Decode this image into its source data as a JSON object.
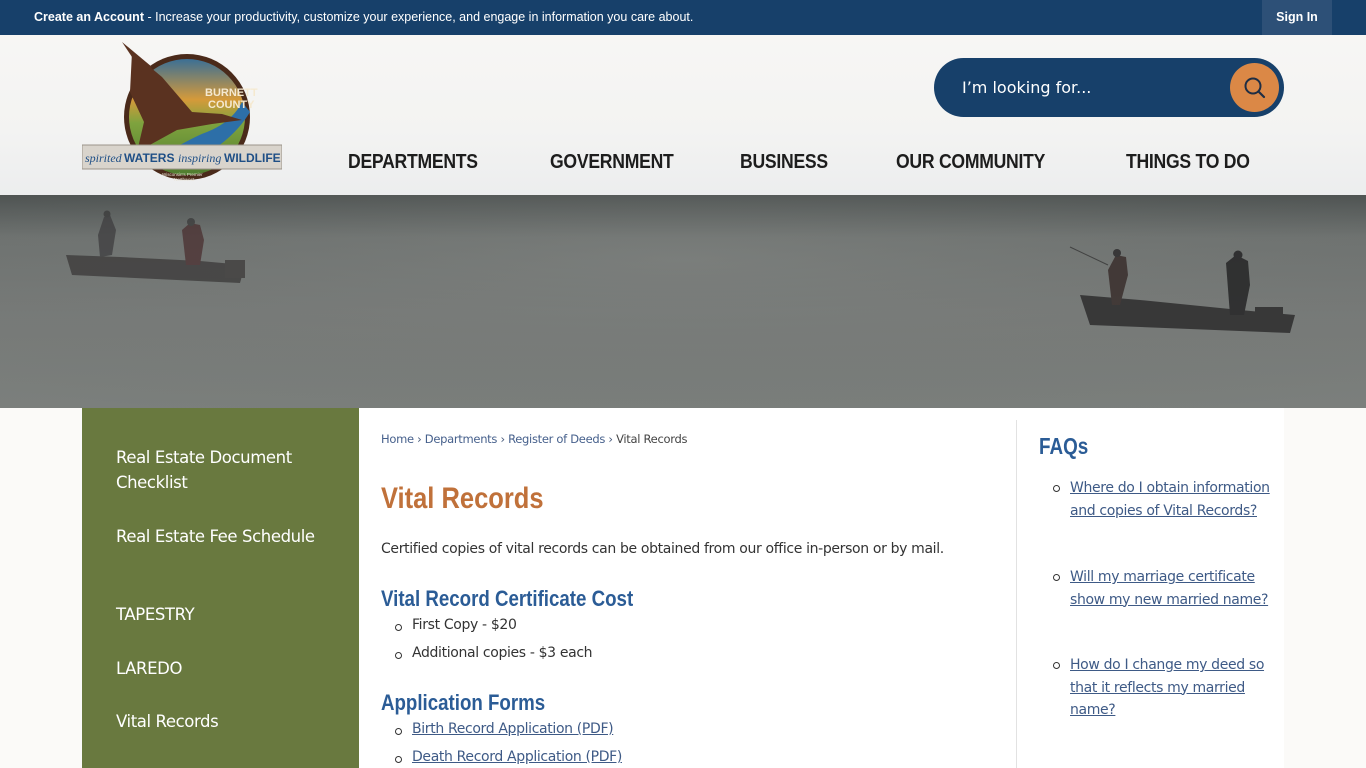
{
  "topbar": {
    "promo_link": "Create an Account",
    "promo_text": " - Increase your productivity, customize your experience, and engage in information you care about.",
    "sign_in": "Sign In"
  },
  "logo": {
    "line1": "BURNETT",
    "line2": "COUNTY",
    "tagline_a": "spirited",
    "tagline_b": "WATERS",
    "tagline_c": "inspiring",
    "tagline_d": "WILDLIFE",
    "sub1": "Wisconsin's Premier",
    "sub2": "Northwest"
  },
  "search": {
    "placeholder": "I’m looking for...",
    "icon": "search-icon"
  },
  "nav": {
    "items": [
      {
        "label": "DEPARTMENTS"
      },
      {
        "label": "GOVERNMENT"
      },
      {
        "label": "BUSINESS"
      },
      {
        "label": "OUR COMMUNITY"
      },
      {
        "label": "THINGS TO DO"
      }
    ]
  },
  "colors": {
    "topbar": "#17406a",
    "accent_orange": "#db8846",
    "title_orange": "#c0713a",
    "heading_blue": "#2b5c96",
    "sidenav_green": "#69793f",
    "link_blue": "#3e5a86"
  },
  "sidenav": {
    "items": [
      {
        "label": "Real Estate Document Checklist"
      },
      {
        "label": "Real Estate Fee Schedule"
      },
      {
        "label": "TAPESTRY"
      },
      {
        "label": "LAREDO"
      },
      {
        "label": "Vital Records"
      }
    ]
  },
  "breadcrumb": {
    "items": [
      {
        "label": "Home"
      },
      {
        "label": "Departments"
      },
      {
        "label": "Register of Deeds"
      }
    ],
    "separator": "›",
    "current": "Vital Records"
  },
  "main": {
    "title": "Vital Records",
    "intro": "Certified copies of vital records can be obtained from our office in-person or by mail.",
    "cost_heading": "Vital Record Certificate Cost",
    "cost_items": [
      "First Copy - $20",
      "Additional copies - $3 each"
    ],
    "forms_heading": "Application Forms",
    "forms_items": [
      "Birth Record Application (PDF)",
      "Death Record Application (PDF)"
    ]
  },
  "faq": {
    "title": "FAQs",
    "items": [
      "Where do I obtain information and copies of Vital Records?",
      "Will my marriage certificate show my new married name?",
      "How do I change my deed so that it reflects my married name?"
    ]
  }
}
